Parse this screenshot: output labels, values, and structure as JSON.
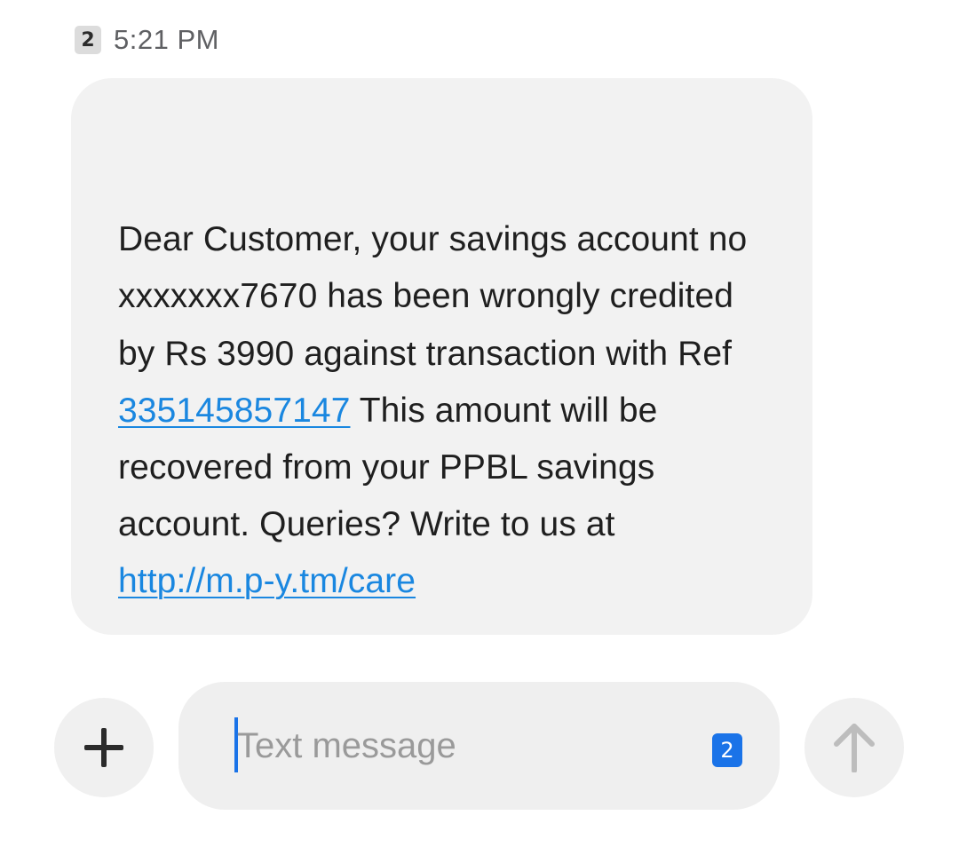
{
  "header": {
    "sim_badge": "2",
    "time": "5:21 PM"
  },
  "message": {
    "text_before_ref": "Dear Customer, your savings account no xxxxxxx7670 has been wrongly credited by Rs 3990 against transaction with Ref ",
    "ref_link": "335145857147",
    "text_after_ref": " This amount will be recovered from your PPBL savings account. Queries? Write to us at ",
    "care_link": "http://m.p-y.tm/care"
  },
  "compose": {
    "placeholder": "Text message",
    "value": "",
    "sim_selector": "2"
  },
  "icons": {
    "add": "plus-icon",
    "send": "arrow-up-icon"
  },
  "colors": {
    "link": "#1a87e0",
    "accent": "#1a73e8",
    "bubble": "#f2f2f2"
  }
}
